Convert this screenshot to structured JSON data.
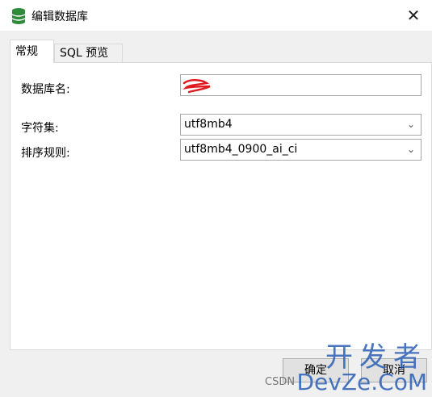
{
  "window": {
    "title": "编辑数据库",
    "close_glyph": "✕"
  },
  "tabs": [
    {
      "label": "常规",
      "active": true
    },
    {
      "label": "SQL 预览",
      "active": false
    }
  ],
  "form": {
    "db_name_label": "数据库名:",
    "charset_label": "字符集:",
    "charset_value": "utf8mb4",
    "collation_label": "排序规则:",
    "collation_value": "utf8mb4_0900_ai_ci"
  },
  "buttons": {
    "ok": "确定",
    "cancel": "取消"
  },
  "watermark": {
    "top": "开发者",
    "bottom": "DevZe.CoM",
    "csdn": "CSDN"
  },
  "colors": {
    "accent": "#2a5fb5",
    "icon": "#2e8b3a",
    "redaction": "#e0191e"
  }
}
